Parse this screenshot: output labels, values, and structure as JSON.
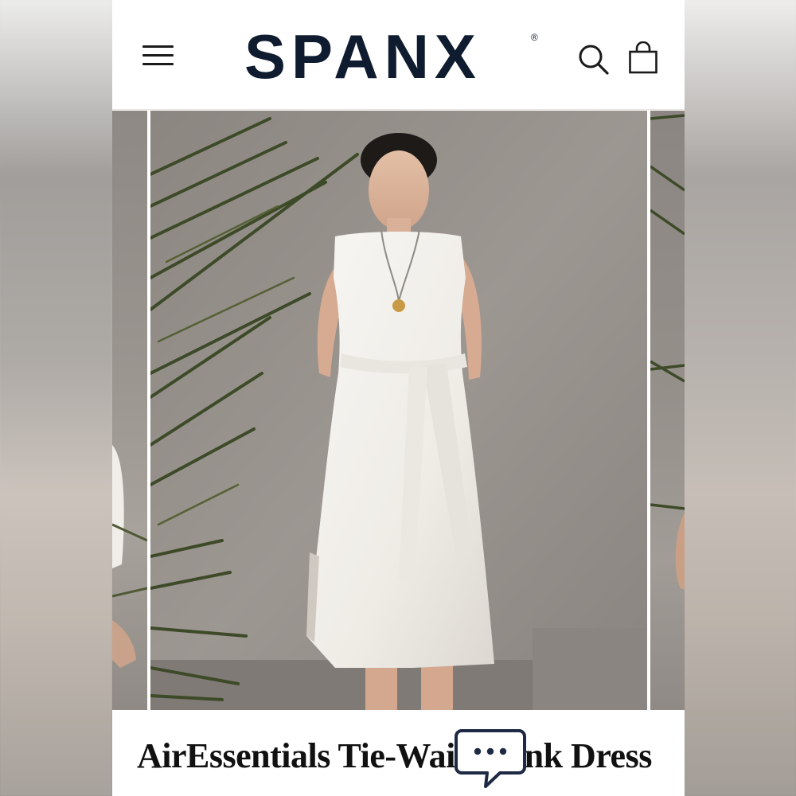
{
  "brand": {
    "name": "SPANX",
    "mark": "®"
  },
  "header": {
    "menu_icon": "hamburger-menu-icon",
    "search_icon": "search-icon",
    "cart_icon": "shopping-bag-icon"
  },
  "product": {
    "title": "AirEssentials Tie-Waist Tank Dress"
  },
  "gallery": {
    "main_image": "model-in-white-tie-waist-tank-dress",
    "prev_image": "previous-product-photo",
    "next_image": "next-product-photo"
  },
  "chat": {
    "icon": "chat-bubble-icon"
  },
  "colors": {
    "brand_navy": "#0f1b2e",
    "dress_white": "#f4f2ee",
    "wall_gray": "#958f8a"
  }
}
